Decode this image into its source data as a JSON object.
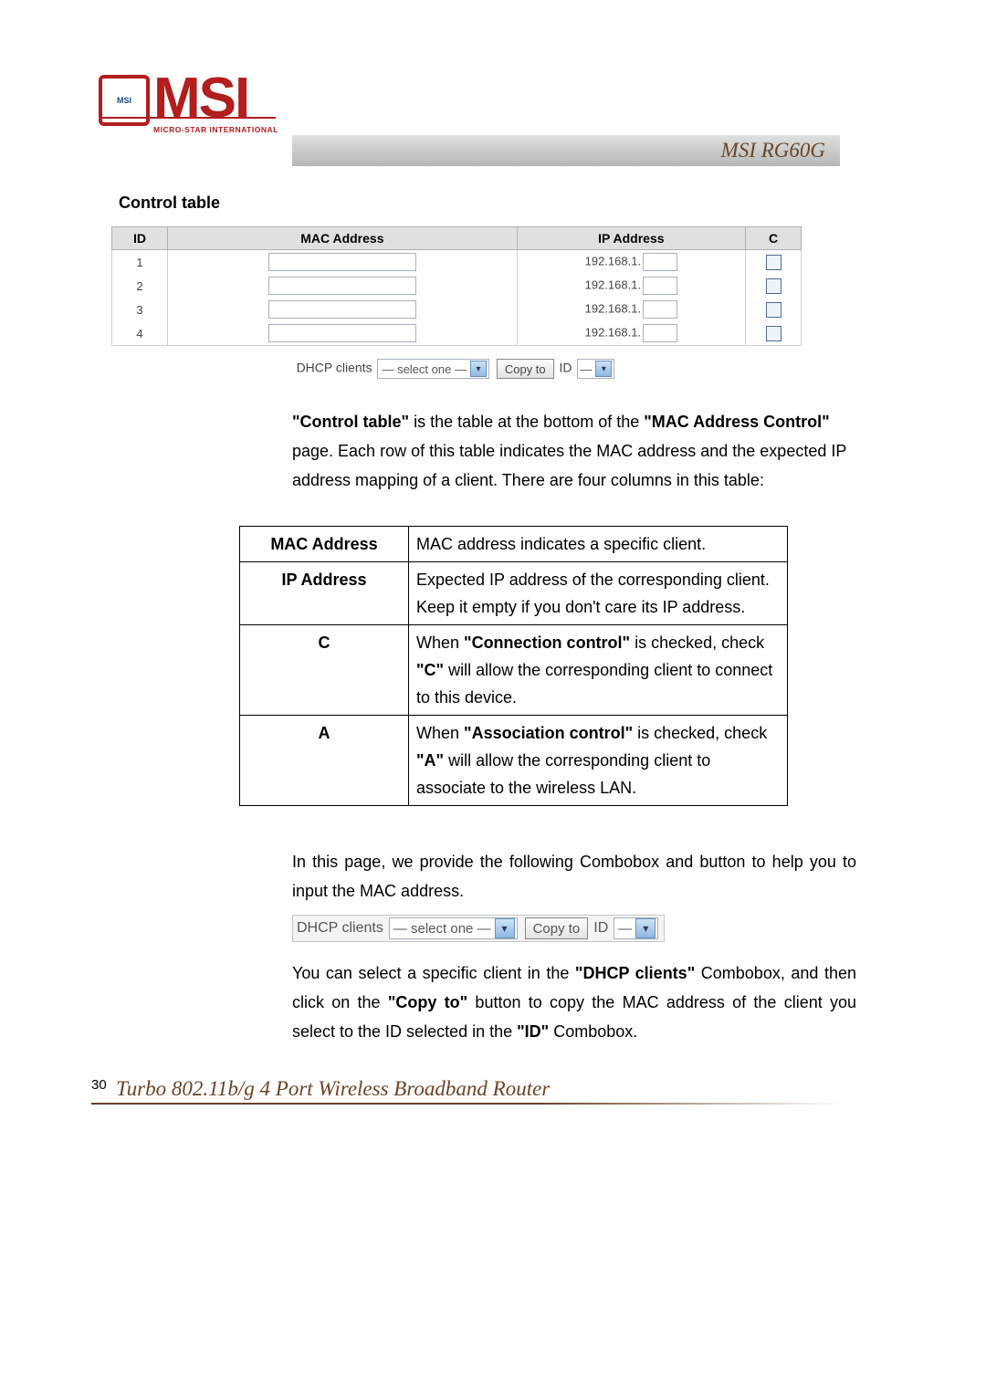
{
  "header": {
    "logo_badge_text": "MSI",
    "logo_name": "MSI",
    "logo_subtext": "MICRO-STAR INTERNATIONAL",
    "product_banner": "MSI RG60G"
  },
  "section_title": "Control table",
  "control_table": {
    "headers": {
      "id": "ID",
      "mac": "MAC Address",
      "ip": "IP Address",
      "c": "C"
    },
    "rows": [
      {
        "id": "1",
        "ip_prefix": "192.168.1."
      },
      {
        "id": "2",
        "ip_prefix": "192.168.1."
      },
      {
        "id": "3",
        "ip_prefix": "192.168.1."
      },
      {
        "id": "4",
        "ip_prefix": "192.168.1."
      }
    ]
  },
  "dhcp": {
    "label": "DHCP clients",
    "select_placeholder": "— select one —",
    "copy_button": "Copy to",
    "id_label": "ID",
    "id_placeholder": "—"
  },
  "para1_a": "\"Control table\"",
  "para1_b": " is the table at the bottom of the ",
  "para1_c": "\"MAC Address Control\"",
  "para1_d": " page. Each row of this table indicates the MAC address and the expected IP address mapping of a client. There are four columns in this table:",
  "def_table": {
    "rows": [
      {
        "label": "MAC Address",
        "text": "MAC address indicates a specific client."
      },
      {
        "label": "IP Address",
        "text": "Expected IP address of the corresponding client. Keep it empty if you don't care its IP address."
      },
      {
        "label": "C",
        "text_pre": "When ",
        "bold1": "\"Connection control\"",
        "mid1": " is checked, check ",
        "bold2": "\"C\"",
        "text_post": " will allow the corresponding client to connect to this device."
      },
      {
        "label": "A",
        "text_pre": "When ",
        "bold1": "\"Association control\"",
        "mid1": " is checked, check ",
        "bold2": "\"A\"",
        "text_post": " will allow the corresponding client to associate to the wireless LAN."
      }
    ]
  },
  "para2": "In this page, we provide the following Combobox and button to help you to input the MAC address.",
  "para3_a": "You can select a specific client in the ",
  "para3_b": "\"DHCP clients\"",
  "para3_c": " Combobox, and then click on the ",
  "para3_d": "\"Copy to\"",
  "para3_e": " button to copy the MAC address of the client you select to the ID selected in the ",
  "para3_f": "\"ID\"",
  "para3_g": " Combobox.",
  "footer": {
    "page_number": "30",
    "title": "Turbo 802.11b/g 4 Port Wireless Broadband Router"
  }
}
